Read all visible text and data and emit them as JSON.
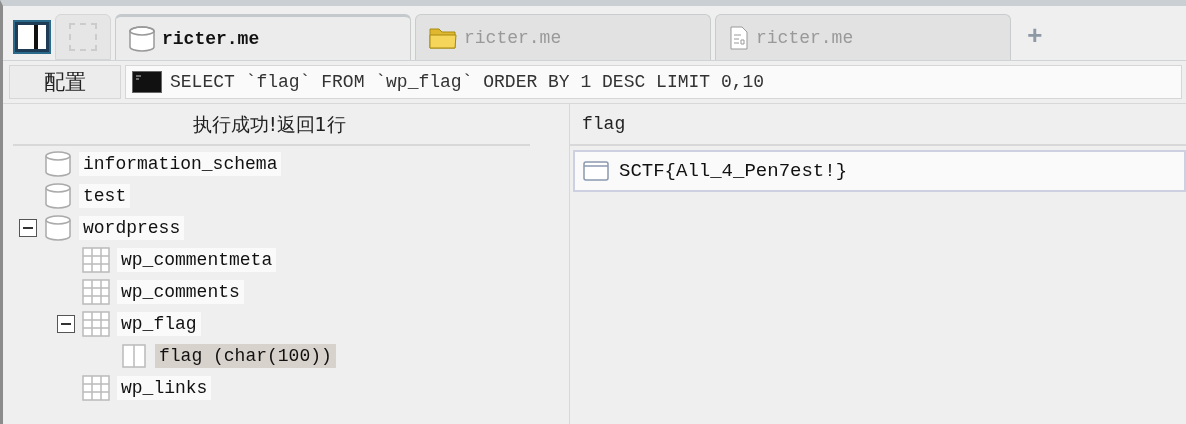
{
  "tabs": [
    {
      "label": "ricter.me",
      "kind": "database",
      "selected": true
    },
    {
      "label": "ricter.me",
      "kind": "files",
      "selected": false
    },
    {
      "label": "ricter.me",
      "kind": "notes",
      "selected": false
    }
  ],
  "new_tab": "+",
  "config_button": "配置",
  "query": "SELECT `flag` FROM `wp_flag` ORDER BY 1 DESC LIMIT 0,10",
  "status": "执行成功!返回1行",
  "tree": [
    {
      "label": "information_schema",
      "kind": "database",
      "selected": false
    },
    {
      "label": "test",
      "kind": "database",
      "selected": false
    },
    {
      "label": "wordpress",
      "kind": "database",
      "selected": false,
      "children": [
        {
          "label": "wp_commentmeta",
          "kind": "table",
          "selected": false
        },
        {
          "label": "wp_comments",
          "kind": "table",
          "selected": false
        },
        {
          "label": "wp_flag",
          "kind": "table",
          "selected": false,
          "children": [
            {
              "label": "flag (char(100))",
              "kind": "column",
              "selected": true
            }
          ]
        },
        {
          "label": "wp_links",
          "kind": "table",
          "selected": false
        }
      ]
    }
  ],
  "result": {
    "columns": [
      "flag"
    ],
    "rows": [
      [
        "SCTF{All_4_Pen7est!}"
      ]
    ]
  }
}
